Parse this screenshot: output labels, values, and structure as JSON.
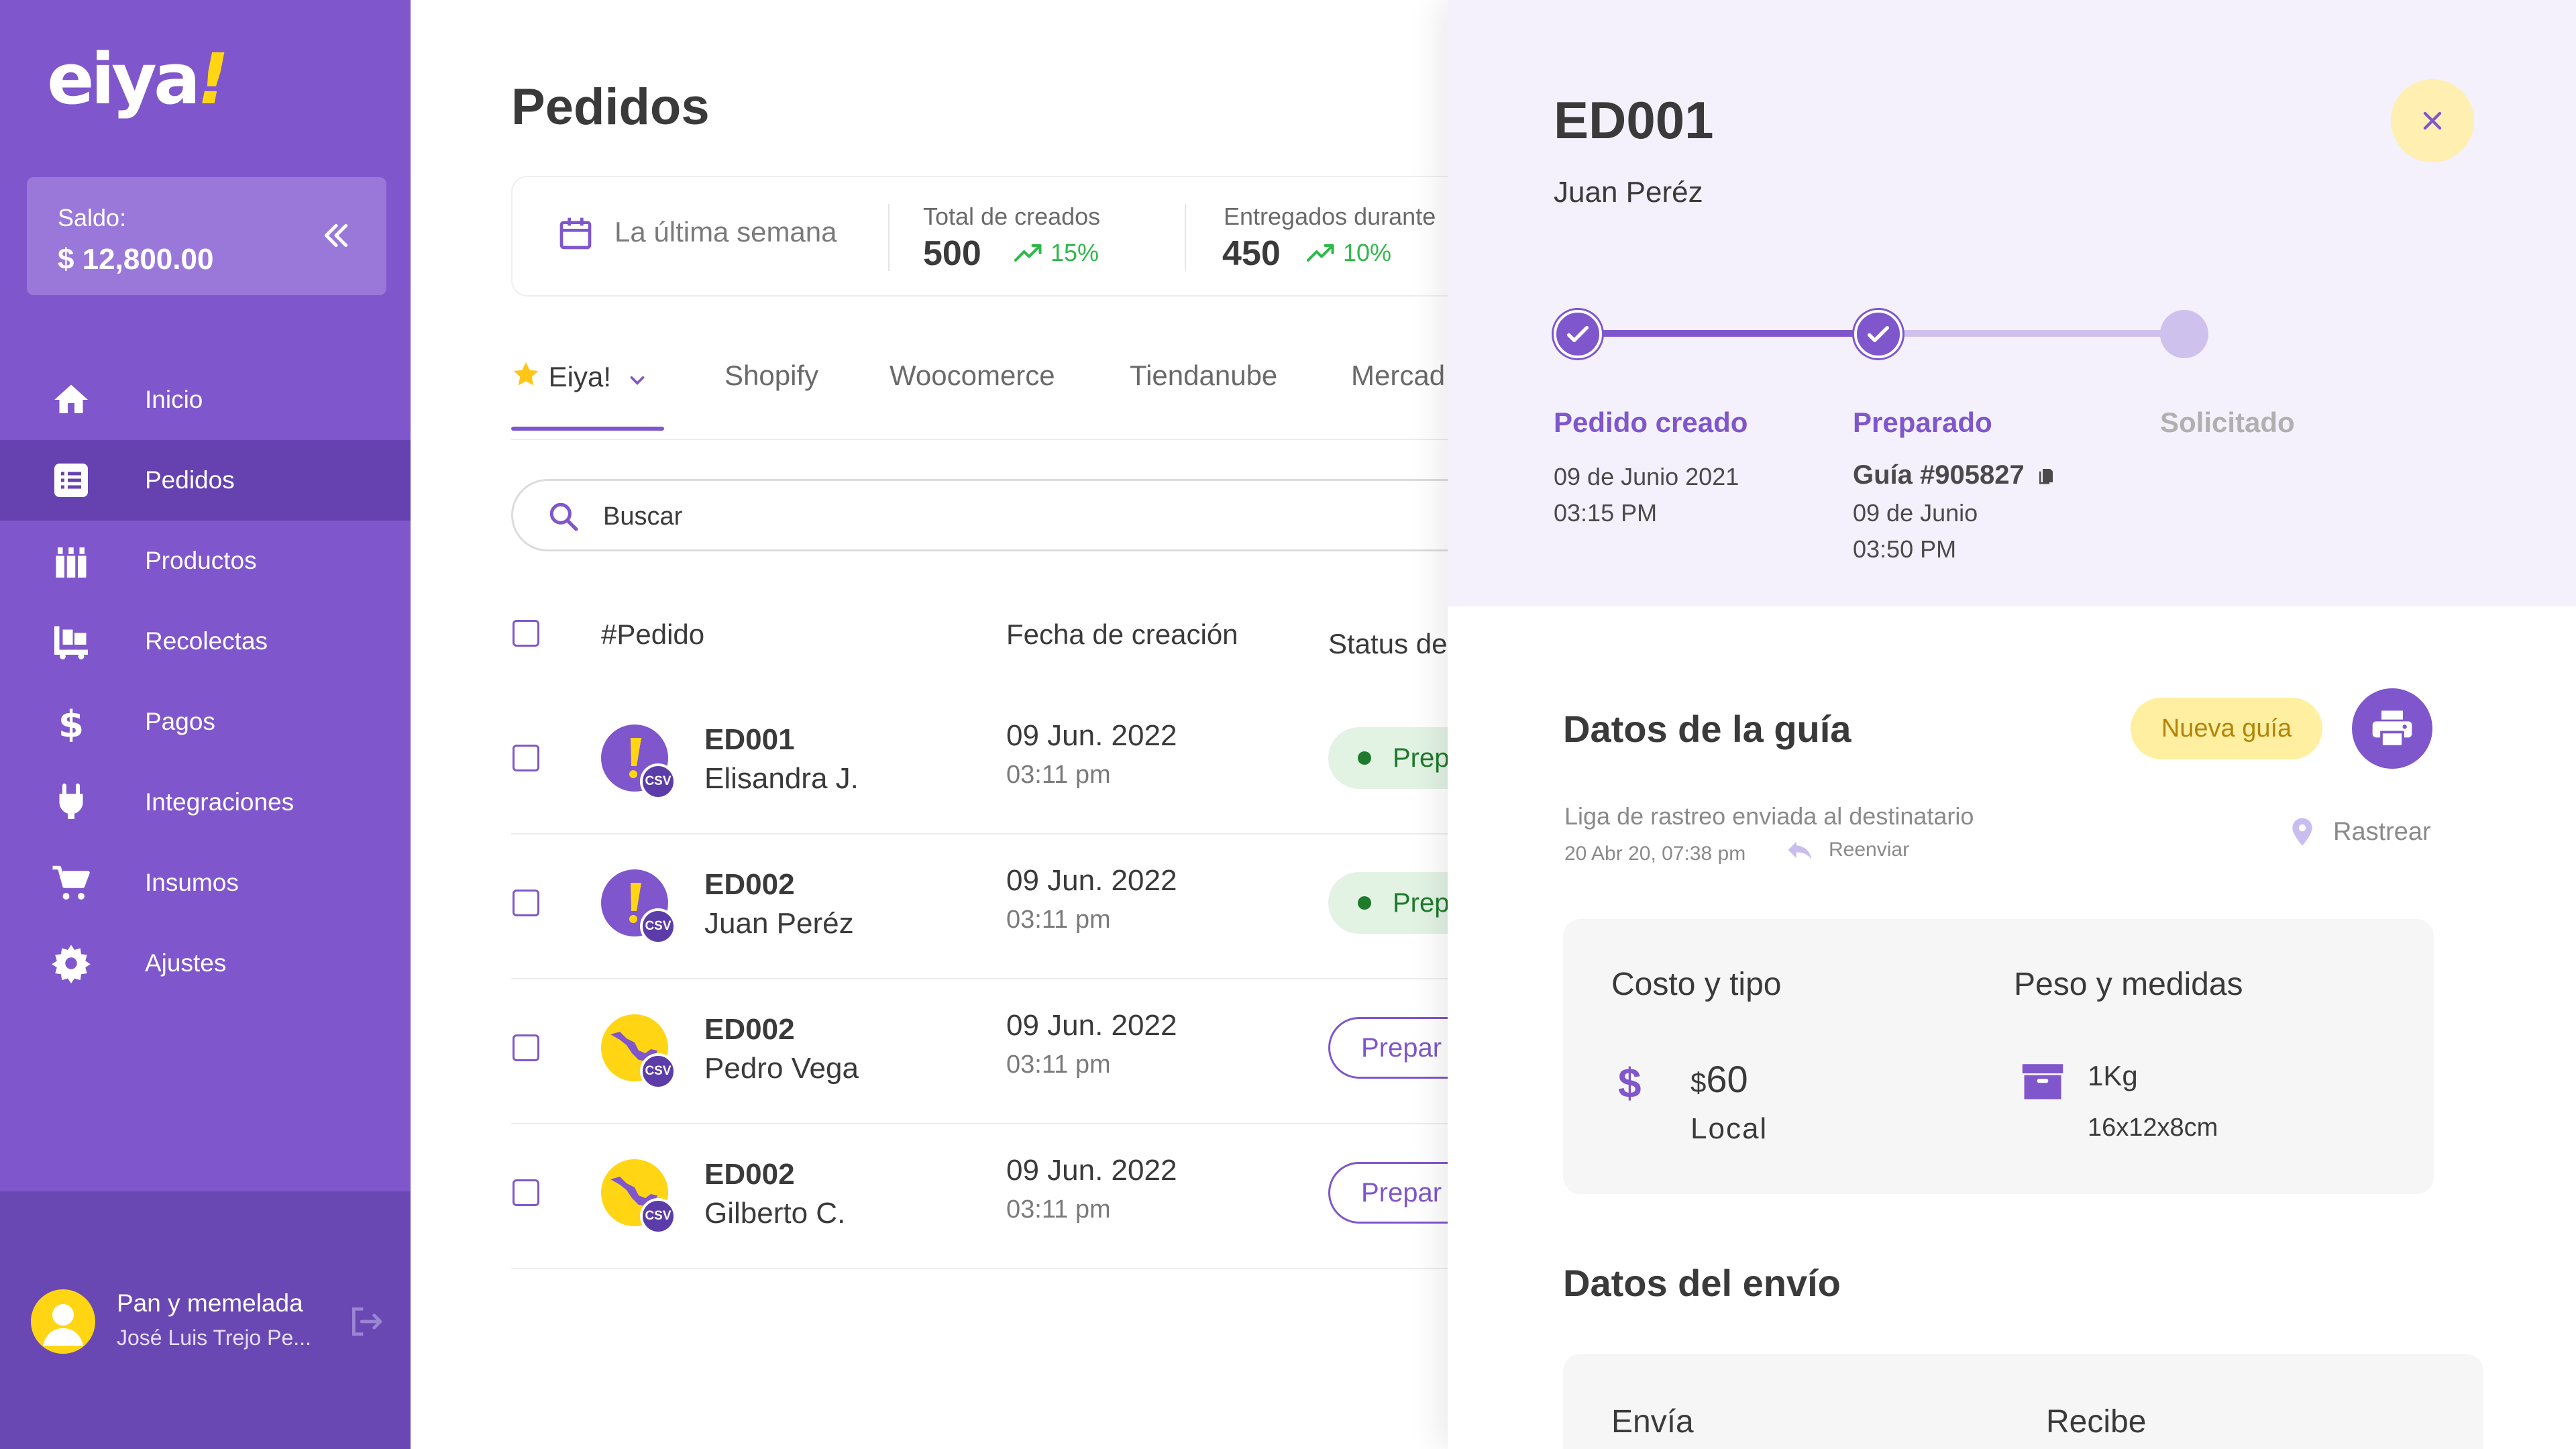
{
  "brand": {
    "logo_text": "eiya",
    "logo_bang": "!",
    "accent": "#7f56cc",
    "accent_dark": "#6642b0",
    "yellow": "#ffd514"
  },
  "sidebar": {
    "balance_label": "Saldo:",
    "balance_value": "$ 12,800.00",
    "items": [
      {
        "label": "Inicio",
        "icon": "home-icon",
        "active": false
      },
      {
        "label": "Pedidos",
        "icon": "list-icon",
        "active": true
      },
      {
        "label": "Productos",
        "icon": "products-icon",
        "active": false
      },
      {
        "label": "Recolectas",
        "icon": "pickup-icon",
        "active": false
      },
      {
        "label": "Pagos",
        "icon": "dollar-icon",
        "active": false
      },
      {
        "label": "Integraciones",
        "icon": "plug-icon",
        "active": false
      },
      {
        "label": "Insumos",
        "icon": "cart-icon",
        "active": false
      },
      {
        "label": "Ajustes",
        "icon": "gear-icon",
        "active": false
      }
    ],
    "user": {
      "business": "Pan y memelada",
      "name": "José Luis Trejo Pe..."
    }
  },
  "main": {
    "title": "Pedidos",
    "stats": {
      "date_range": "La última semana",
      "created_label": "Total de creados",
      "created_value": "500",
      "created_trend": "15%",
      "delivered_label": "Entregados durante",
      "delivered_value": "450",
      "delivered_trend": "10%"
    },
    "tabs": [
      "Eiya!",
      "Shopify",
      "Woocomerce",
      "Tiendanube",
      "Mercad"
    ],
    "search_value": "Buscar",
    "columns": [
      "#Pedido",
      "Fecha de creación",
      "Status de"
    ],
    "rows": [
      {
        "id": "ED001",
        "name": "Elisandra J.",
        "date": "09 Jun. 2022",
        "time": "03:11 pm",
        "status": "Prep",
        "status_style": "filled",
        "source": "eiya",
        "tag": "CSV"
      },
      {
        "id": "ED002",
        "name": "Juan Peréz",
        "date": "09 Jun. 2022",
        "time": "03:11 pm",
        "status": "Prep",
        "status_style": "filled",
        "source": "eiya",
        "tag": "CSV"
      },
      {
        "id": "ED002",
        "name": "Pedro Vega",
        "date": "09 Jun. 2022",
        "time": "03:11 pm",
        "status": "Prepar",
        "status_style": "outline",
        "source": "mexico",
        "tag": "CSV"
      },
      {
        "id": "ED002",
        "name": "Gilberto C.",
        "date": "09 Jun. 2022",
        "time": "03:11 pm",
        "status": "Prepar",
        "status_style": "outline",
        "source": "mexico",
        "tag": "CSV"
      }
    ]
  },
  "detail": {
    "order_id": "ED001",
    "customer": "Juan Peréz",
    "steps": [
      {
        "title": "Pedido creado",
        "lines": [
          "09 de Junio 2021",
          "03:15 PM"
        ],
        "done": true
      },
      {
        "title": "Preparado",
        "guide": "Guía #905827",
        "lines": [
          "09 de Junio",
          "03:50 PM"
        ],
        "done": true
      },
      {
        "title": "Solicitado",
        "lines": [],
        "done": false
      }
    ],
    "guide_section": {
      "title": "Datos de la guía",
      "new_guide_label": "Nueva guía",
      "tracking_note": "Liga de rastreo enviada al destinatario",
      "tracking_time": "20 Abr 20, 07:38 pm",
      "resend_label": "Reenviar",
      "track_label": "Rastrear"
    },
    "cost": {
      "cost_title": "Costo y tipo",
      "currency": "$",
      "price": "60",
      "type": "Local",
      "size_title": "Peso y medidas",
      "weight": "1Kg",
      "dimensions": "16x12x8cm"
    },
    "shipping": {
      "title": "Datos del envío",
      "sender_label": "Envía",
      "receiver_label": "Recibe"
    }
  }
}
